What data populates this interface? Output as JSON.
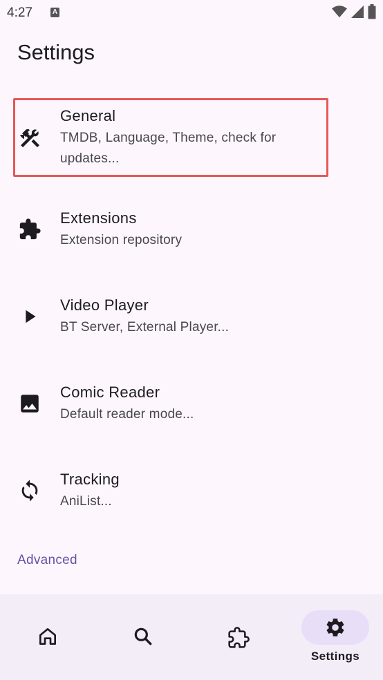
{
  "status_bar": {
    "time": "4:27",
    "notification_letter": "A"
  },
  "page": {
    "title": "Settings"
  },
  "settings": [
    {
      "title": "General",
      "subtitle": "TMDB, Language, Theme, check for updates...",
      "icon": "tools-icon"
    },
    {
      "title": "Extensions",
      "subtitle": "Extension repository",
      "icon": "puzzle-icon"
    },
    {
      "title": "Video Player",
      "subtitle": "BT Server, External Player...",
      "icon": "play-icon"
    },
    {
      "title": "Comic Reader",
      "subtitle": "Default reader mode...",
      "icon": "image-icon"
    },
    {
      "title": "Tracking",
      "subtitle": "AniList...",
      "icon": "sync-icon"
    }
  ],
  "advanced": {
    "label": "Advanced"
  },
  "bottom_nav": {
    "items": [
      {
        "icon": "home-icon"
      },
      {
        "icon": "search-icon"
      },
      {
        "icon": "extension-icon"
      },
      {
        "icon": "gear-icon",
        "label": "Settings",
        "selected": true
      }
    ]
  },
  "colors": {
    "background": "#fdf7fd",
    "accent": "#6750a4",
    "highlight": "#e85656",
    "nav_background": "#f3edf7",
    "nav_pill": "#e8def8"
  }
}
